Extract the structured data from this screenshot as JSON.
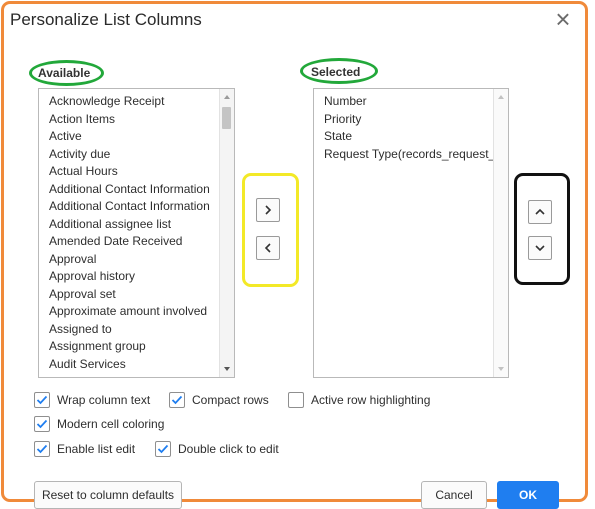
{
  "dialog": {
    "title": "Personalize List Columns",
    "close_glyph": "×"
  },
  "available": {
    "label": "Available",
    "items": [
      "Acknowledge Receipt",
      "Action Items",
      "Active",
      "Activity due",
      "Actual Hours",
      "Additional Contact Information",
      "Additional Contact Information",
      "Additional assignee list",
      "Amended Date Received",
      "Approval",
      "Approval history",
      "Approval set",
      "Approximate amount involved",
      "Assigned to",
      "Assignment group",
      "Audit Services"
    ]
  },
  "selected": {
    "label": "Selected",
    "items": [
      "Number",
      "Priority",
      "State",
      "Request Type(records_request_"
    ]
  },
  "options": {
    "wrap_column_text": {
      "label": "Wrap column text",
      "checked": true
    },
    "compact_rows": {
      "label": "Compact rows",
      "checked": true
    },
    "active_row_highlighting": {
      "label": "Active row highlighting",
      "checked": false
    },
    "modern_cell_coloring": {
      "label": "Modern cell coloring",
      "checked": true
    },
    "enable_list_edit": {
      "label": "Enable list edit",
      "checked": true
    },
    "double_click_to_edit": {
      "label": "Double click to edit",
      "checked": true
    }
  },
  "footer": {
    "reset_label": "Reset to column defaults",
    "cancel_label": "Cancel",
    "ok_label": "OK"
  },
  "colors": {
    "frame": "#f08a3a",
    "label_highlight": "#22a83a",
    "move_highlight": "#f3e927",
    "order_highlight": "#111111",
    "primary": "#1f7ef0",
    "checkmark": "#1f7ef0"
  },
  "icons": {
    "move_right": "chevron-right-icon",
    "move_left": "chevron-left-icon",
    "move_up": "chevron-up-icon",
    "move_down": "chevron-down-icon"
  }
}
